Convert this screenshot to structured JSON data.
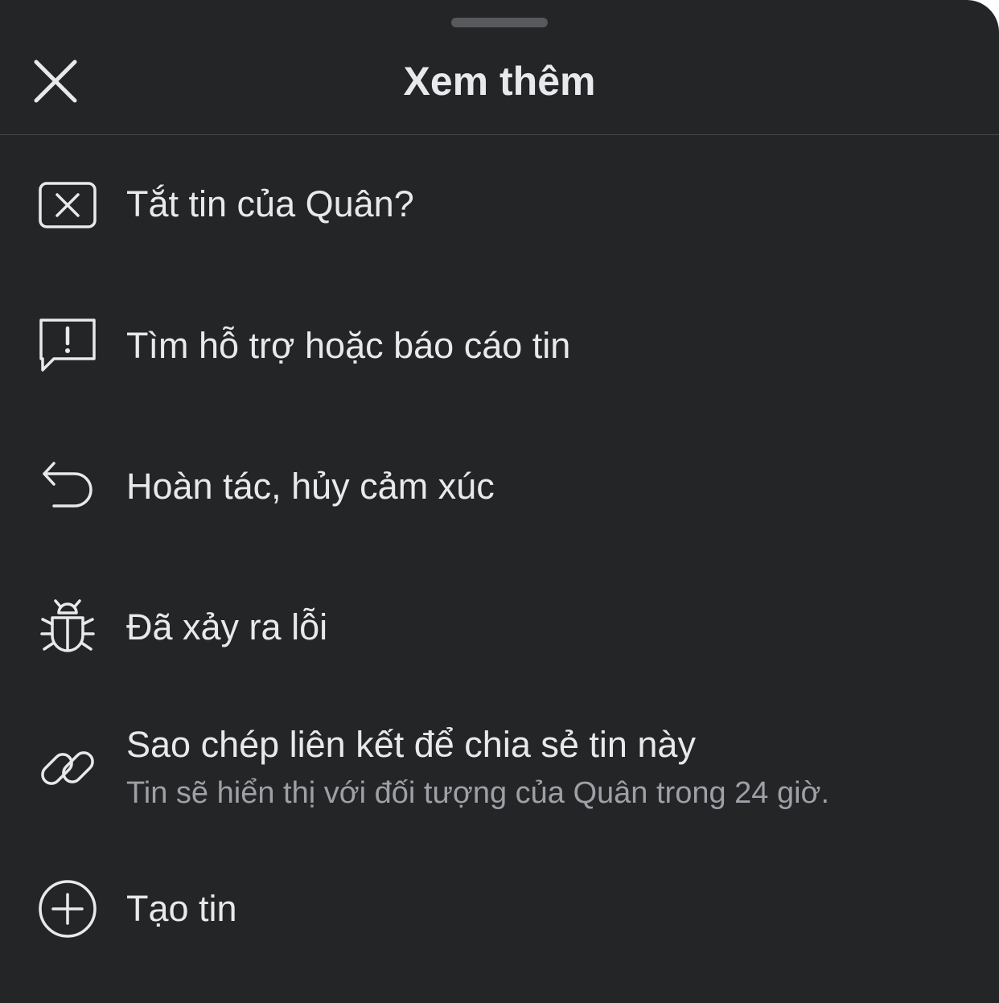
{
  "sheet": {
    "title": "Xem thêm",
    "close_icon": "close-icon"
  },
  "menu": {
    "items": [
      {
        "icon": "close-square-icon",
        "label": "Tắt tin của Quân?"
      },
      {
        "icon": "report-speech-icon",
        "label": "Tìm hỗ trợ hoặc báo cáo tin"
      },
      {
        "icon": "undo-icon",
        "label": "Hoàn tác, hủy cảm xúc"
      },
      {
        "icon": "bug-icon",
        "label": "Đã xảy ra lỗi"
      },
      {
        "icon": "link-icon",
        "label": "Sao chép liên kết để chia sẻ tin này",
        "sub": "Tin sẽ hiển thị với đối tượng của Quân trong 24 giờ."
      },
      {
        "icon": "plus-circle-icon",
        "label": "Tạo tin"
      }
    ]
  },
  "colors": {
    "background": "#242527",
    "text": "#e8e9ec",
    "secondary_text": "#9ea0a6",
    "divider": "#46474a"
  }
}
